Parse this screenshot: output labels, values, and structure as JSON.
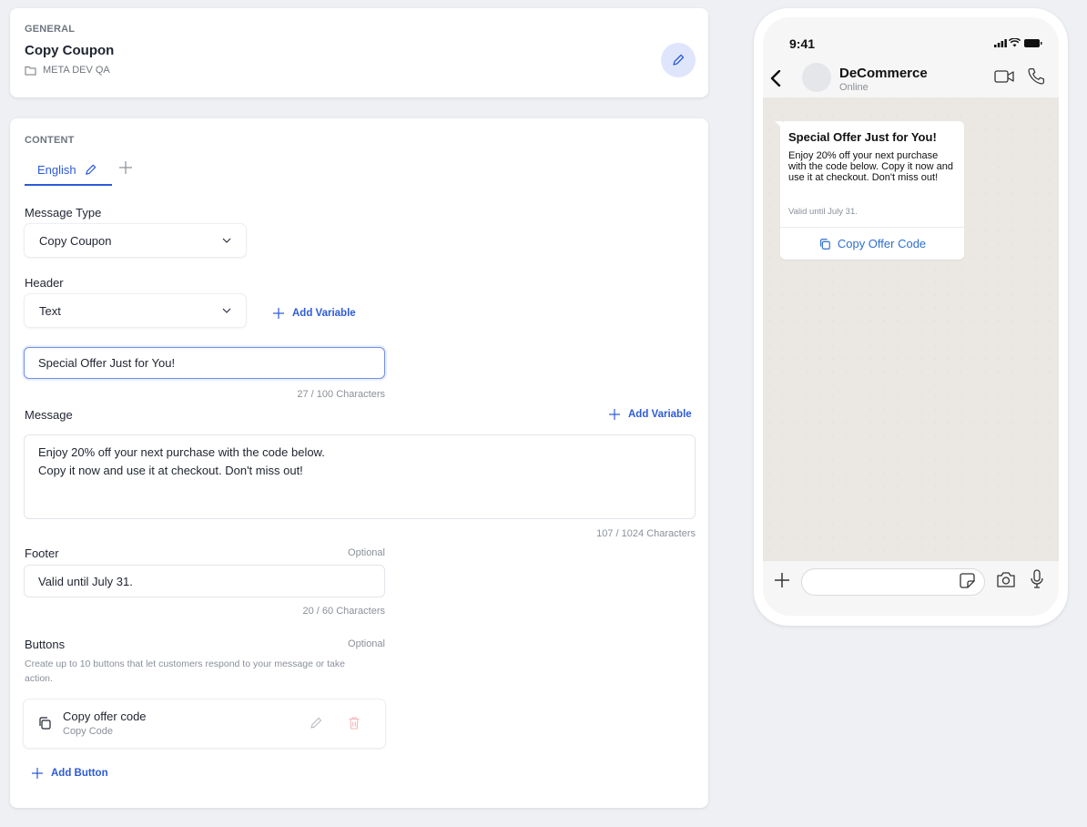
{
  "general": {
    "section_label": "GENERAL",
    "title": "Copy Coupon",
    "folder": "META DEV QA"
  },
  "content": {
    "section_label": "CONTENT",
    "tab_label": "English",
    "message_type": {
      "label": "Message Type",
      "value": "Copy Coupon"
    },
    "header": {
      "label": "Header",
      "type_value": "Text",
      "add_variable": "Add Variable",
      "text_value": "Special Offer Just for You!",
      "counter": "27 / 100 Characters"
    },
    "message": {
      "label": "Message",
      "add_variable": "Add Variable",
      "lines": [
        "Enjoy 20% off your next purchase with the code below.",
        "Copy it now and use it at checkout. Don't miss out!"
      ],
      "counter": "107 / 1024 Characters"
    },
    "footer": {
      "label": "Footer",
      "optional": "Optional",
      "value": "Valid until July 31.",
      "counter": "20 / 60 Characters"
    },
    "buttons": {
      "label": "Buttons",
      "optional": "Optional",
      "hint": "Create up to 10 buttons that let customers respond to your message or take action.",
      "items": [
        {
          "name": "Copy offer code",
          "type": "Copy Code"
        }
      ],
      "add_button": "Add Button"
    }
  },
  "preview": {
    "time": "9:41",
    "contact_name": "DeCommerce",
    "contact_status": "Online",
    "bubble": {
      "title": "Special Offer Just for You!",
      "body": "Enjoy 20% off your next purchase with the code below. Copy it now and use it at checkout. Don't miss out!",
      "footer": "Valid until July 31.",
      "button": "Copy Offer Code"
    }
  },
  "colors": {
    "accent": "#2d5bd7",
    "background": "#eef0f3",
    "chat_background": "#ebe7e3",
    "danger_muted": "#f3b6b6"
  }
}
